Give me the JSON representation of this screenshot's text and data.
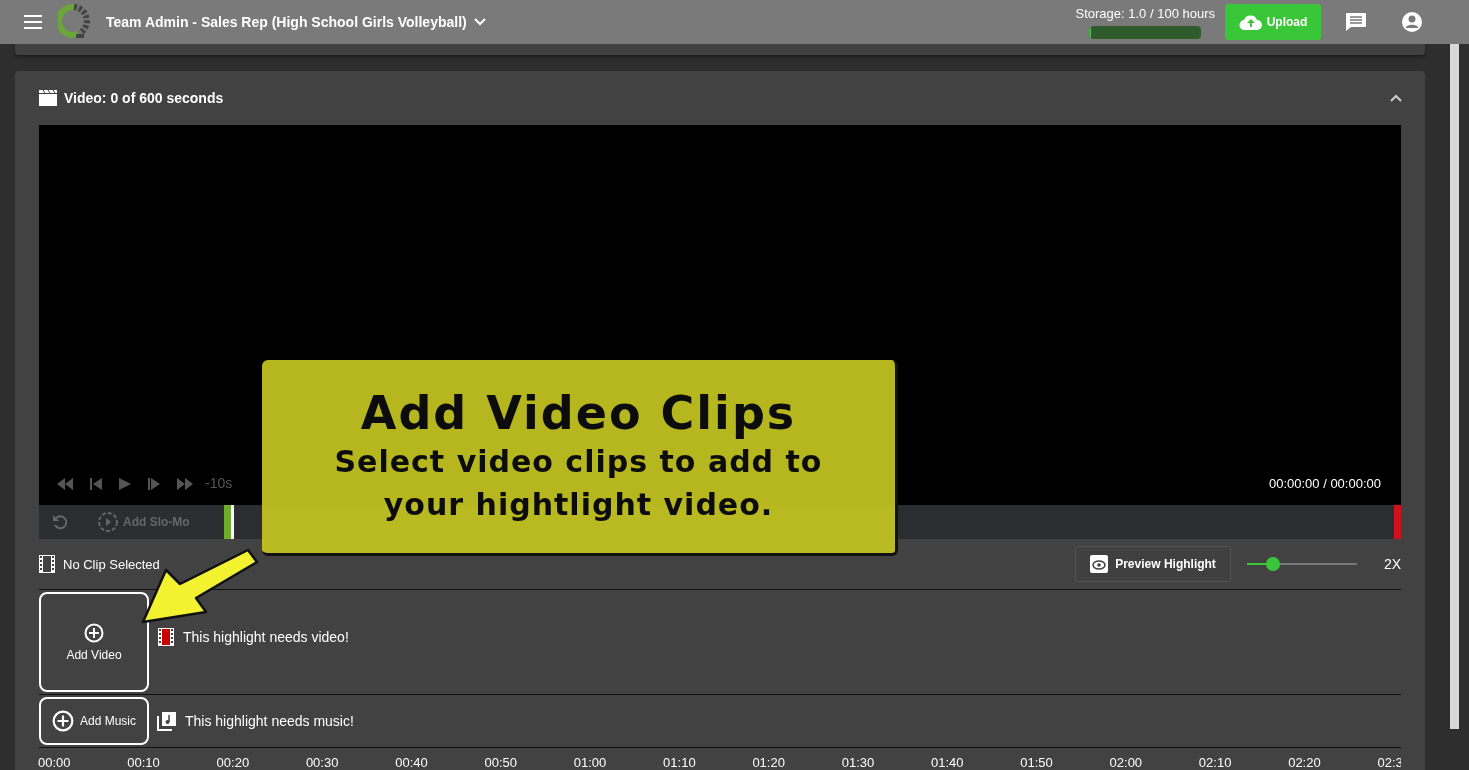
{
  "top_bar": {
    "title": "Team Admin - Sales Rep (High School Girls Volleyball)",
    "storage": {
      "label": "Storage: 1.0 / 100 hours",
      "level": 0.01
    },
    "upload_button": "Upload"
  },
  "video_card": {
    "title": "Video: 0 of 600 seconds",
    "expanded": true
  },
  "player": {
    "skip_buttons": [
      "-10s"
    ],
    "time": "00:00:00 / 00:00:00"
  },
  "trim_bar": {
    "slo_mo_button": "Add Slo-Mo"
  },
  "clip_status": "No Clip Selected",
  "preview_button": "Preview Highlight",
  "speed": {
    "level": 0.24,
    "label": "2X"
  },
  "tracks": [
    {
      "kind": "video",
      "button": "Add Video",
      "message": "This highlight needs video!"
    },
    {
      "kind": "music",
      "button": "Add Music",
      "message": "This highlight needs music!"
    }
  ],
  "timeline": [
    "00:00",
    "00:10",
    "00:20",
    "00:30",
    "00:40",
    "00:50",
    "01:00",
    "01:10",
    "01:20",
    "01:30",
    "01:40",
    "01:50",
    "02:00",
    "02:10",
    "02:20",
    "02:3"
  ],
  "tooltip": {
    "title": "Add Video Clips",
    "body": "Select video clips to add to your hightlight video."
  }
}
